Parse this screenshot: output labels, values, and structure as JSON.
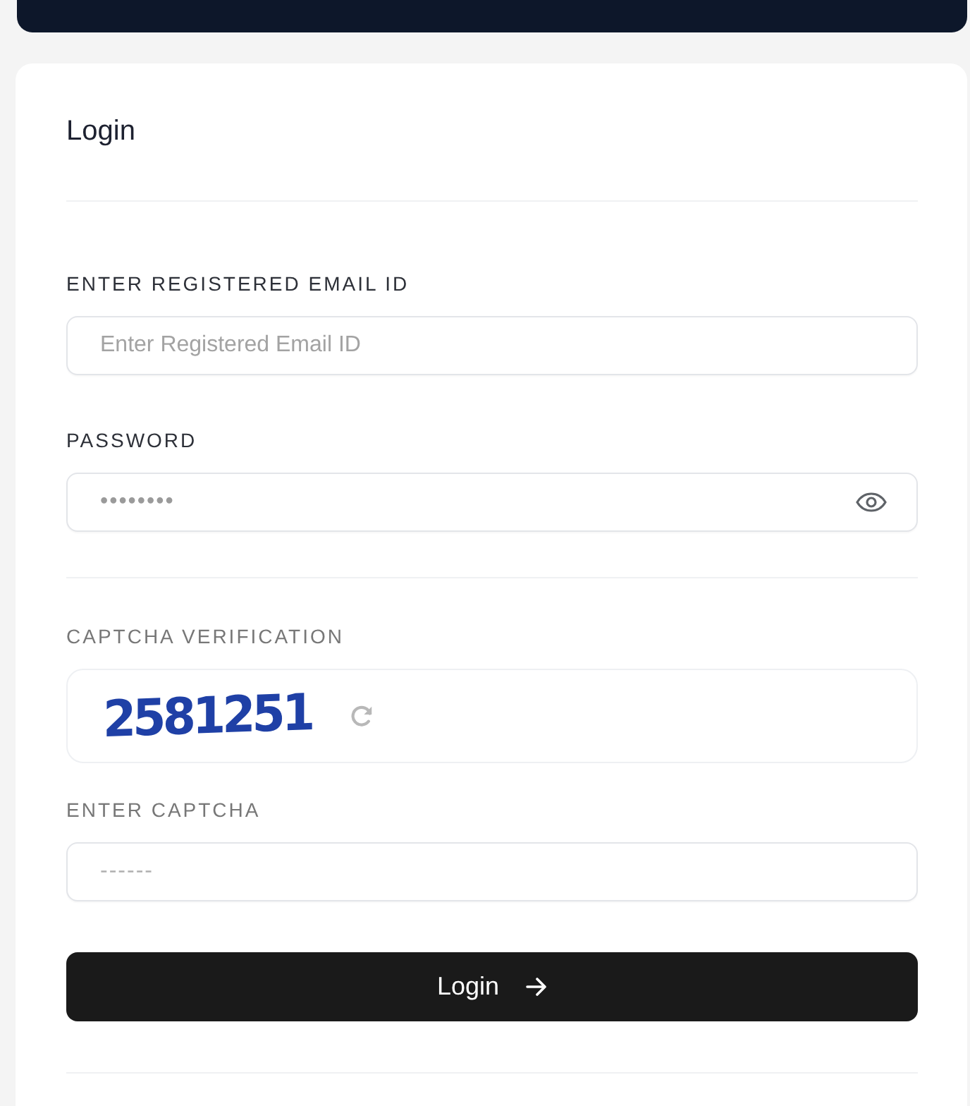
{
  "login_card": {
    "title": "Login",
    "fields": [
      {
        "kind": "text",
        "label": "ENTER REGISTERED EMAIL ID",
        "placeholder": "Enter Registered Email ID"
      },
      {
        "kind": "password",
        "label": "PASSWORD",
        "placeholder": "••••••••"
      }
    ],
    "captcha": {
      "label": "CAPTCHA VERIFICATION",
      "code": "2581251",
      "input": {
        "label": "ENTER CAPTCHA",
        "placeholder": "------"
      }
    },
    "submit_button": {
      "label": "Login"
    }
  }
}
